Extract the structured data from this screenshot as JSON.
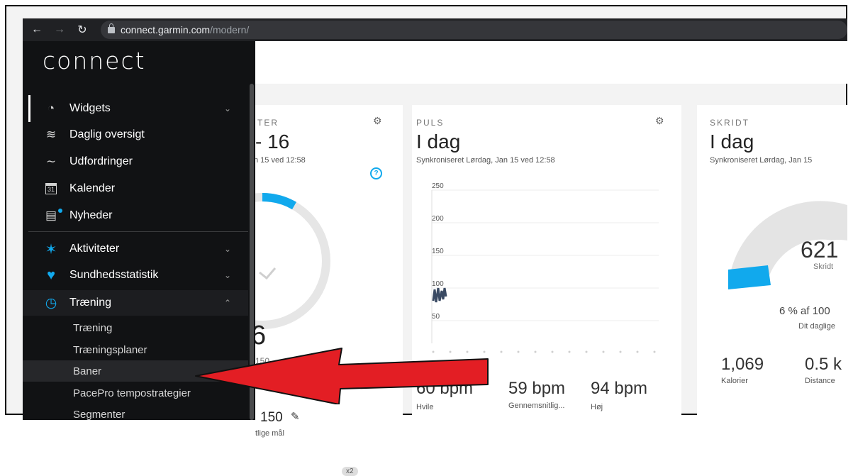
{
  "browser": {
    "url_host": "connect.garmin.com",
    "url_path": "/modern/"
  },
  "app": {
    "logo": "connect"
  },
  "sidebar": {
    "items": [
      {
        "label": "Widgets"
      },
      {
        "label": "Daglig oversigt"
      },
      {
        "label": "Udfordringer"
      },
      {
        "label": "Kalender",
        "icon_text": "31"
      },
      {
        "label": "Nyheder"
      },
      {
        "label": "Aktiviteter"
      },
      {
        "label": "Sundhedsstatistik"
      },
      {
        "label": "Træning"
      }
    ],
    "sub_items": [
      {
        "label": "Træning"
      },
      {
        "label": "Træningsplaner"
      },
      {
        "label": "Baner"
      },
      {
        "label": "PacePro tempostrategier"
      },
      {
        "label": "Segmenter"
      }
    ]
  },
  "cards": {
    "first": {
      "label": "TER",
      "title": "- 16",
      "sync": "n 15 ved 12:58",
      "big_value": "6",
      "small_value": "150",
      "goal_value": "150",
      "goal_label": "tlige mål",
      "badge": "x2",
      "progress": 0.06
    },
    "puls": {
      "label": "PULS",
      "title": "I dag",
      "sync": "Synkroniseret Lørdag, Jan 15 ved 12:58",
      "yticks": [
        "250",
        "200",
        "150",
        "100",
        "50"
      ],
      "stats": [
        {
          "value": "60 bpm",
          "label": "Hvile"
        },
        {
          "value": "59 bpm",
          "label": "Gennemsnitlig..."
        },
        {
          "value": "94 bpm",
          "label": "Høj"
        }
      ]
    },
    "skridt": {
      "label": "SKRIDT",
      "title": "I dag",
      "sync": "Synkroniseret Lørdag, Jan 15",
      "steps": "621",
      "steps_label": "Skridt",
      "percent_text": "6 % af 100",
      "goal_text": "Dit daglige",
      "stats": [
        {
          "value": "1,069",
          "label": "Kalorier"
        },
        {
          "value": "0.5 k",
          "label": "Distance"
        }
      ],
      "progress": 0.06
    }
  },
  "colors": {
    "accent": "#11a9ed",
    "sidebar_bg": "#111214",
    "arrow": "#e31e24"
  }
}
